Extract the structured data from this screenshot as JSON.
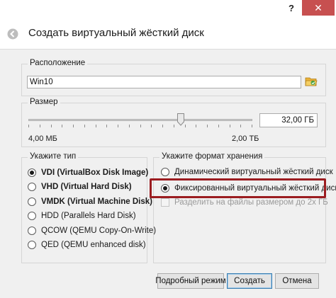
{
  "window": {
    "help_label": "?",
    "close_label": "✕"
  },
  "wizard": {
    "back_icon": "arrow-left-icon",
    "title": "Создать виртуальный жёсткий диск"
  },
  "location": {
    "group_title": "Расположение",
    "value": "Win10",
    "folder_icon": "folder-open-icon"
  },
  "size": {
    "group_title": "Размер",
    "value": "32,00 ГБ",
    "min_label": "4,00 МБ",
    "max_label": "2,00 ТБ",
    "slider_fraction": 0.68
  },
  "disk_type": {
    "group_title": "Укажите тип",
    "options": [
      {
        "label": "VDI (VirtualBox Disk Image)",
        "checked": true,
        "bold": true
      },
      {
        "label": "VHD (Virtual Hard Disk)",
        "checked": false,
        "bold": true
      },
      {
        "label": "VMDK (Virtual Machine Disk)",
        "checked": false,
        "bold": true
      },
      {
        "label": "HDD (Parallels Hard Disk)",
        "checked": false,
        "bold": false
      },
      {
        "label": "QCOW (QEMU Copy-On-Write)",
        "checked": false,
        "bold": false
      },
      {
        "label": "QED (QEMU enhanced disk)",
        "checked": false,
        "bold": false
      }
    ]
  },
  "storage_format": {
    "group_title": "Укажите формат хранения",
    "options": [
      {
        "label": "Динамический виртуальный жёсткий диск",
        "checked": false
      },
      {
        "label": "Фиксированный виртуальный жёсткий диск",
        "checked": true
      }
    ],
    "split_label": "Разделить на файлы размером до 2х ГБ",
    "split_enabled": false,
    "highlight_color": "#9b1c20"
  },
  "buttons": {
    "expert": "Подробный режим",
    "create": "Создать",
    "cancel": "Отмена"
  }
}
